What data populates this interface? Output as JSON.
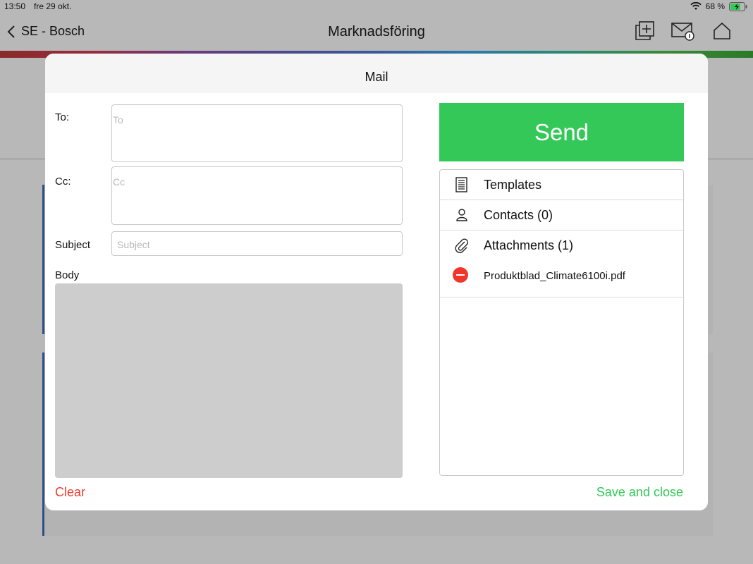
{
  "status_bar": {
    "time": "13:50",
    "date": "fre 29 okt.",
    "battery": "68 %"
  },
  "nav": {
    "back_label": "SE - Bosch",
    "title": "Marknadsföring"
  },
  "modal": {
    "title": "Mail",
    "fields": {
      "to_label": "To:",
      "to_placeholder": "To",
      "cc_label": "Cc:",
      "cc_placeholder": "Cc",
      "subject_label": "Subject",
      "subject_placeholder": "Subject",
      "body_label": "Body"
    },
    "send_label": "Send",
    "panel": {
      "templates_label": "Templates",
      "contacts_label": "Contacts (0)",
      "attachments_label": "Attachments (1)",
      "attachments": [
        {
          "name": "Produktblad_Climate6100i.pdf"
        }
      ]
    },
    "clear_label": "Clear",
    "save_close_label": "Save and close"
  },
  "colors": {
    "accent_green": "#33c858",
    "destructive_red": "#f23a2e"
  }
}
